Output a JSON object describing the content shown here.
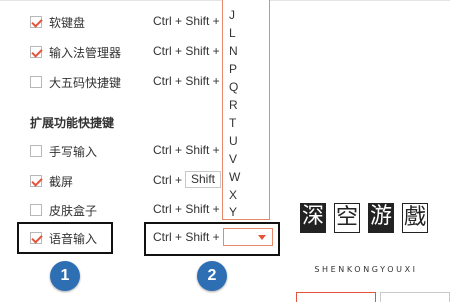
{
  "shortcuts_top": [
    {
      "label": "软键盘",
      "checked": true,
      "shortcut": "Ctrl + Shift +"
    },
    {
      "label": "输入法管理器",
      "checked": true,
      "shortcut": "Ctrl + Shift +"
    },
    {
      "label": "大五码快捷键",
      "checked": false,
      "shortcut": "Ctrl + Shift +"
    }
  ],
  "section_title": "扩展功能快捷键",
  "shortcuts_ext": [
    {
      "label": "手写输入",
      "checked": false,
      "shortcut": "Ctrl + Shift +"
    },
    {
      "label": "截屏",
      "checked": true,
      "shortcut": "Ctrl +",
      "modifier_select": "Shift"
    },
    {
      "label": "皮肤盒子",
      "checked": false,
      "shortcut": "Ctrl + Shift +"
    },
    {
      "label": "语音输入",
      "checked": true,
      "shortcut": "Ctrl + Shift +"
    }
  ],
  "key_dropdown_options": [
    "J",
    "L",
    "N",
    "P",
    "Q",
    "R",
    "T",
    "U",
    "V",
    "W",
    "X",
    "Y"
  ],
  "key_dropdown_value": "",
  "annotations": {
    "badge1": "1",
    "badge2": "2"
  },
  "watermark": {
    "chars": [
      "深",
      "空",
      "游",
      "戲"
    ],
    "latin": "SHENKONGYOUXI"
  },
  "colors": {
    "accent": "#e5533c",
    "badge": "#2e6fb4"
  }
}
